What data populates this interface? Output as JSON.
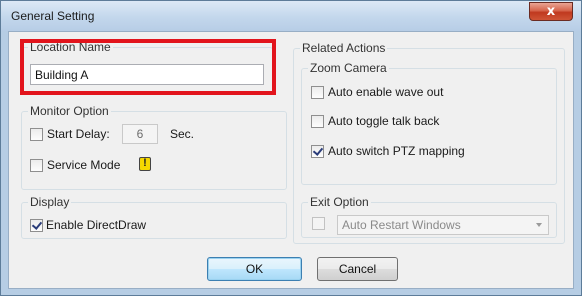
{
  "window": {
    "title": "General Setting",
    "close_glyph": "x"
  },
  "location": {
    "group_label": "Location Name",
    "value": "Building A"
  },
  "monitor": {
    "group_label": "Monitor Option",
    "start_delay_label": "Start Delay:",
    "start_delay_checked": false,
    "delay_value": "6",
    "delay_unit": "Sec.",
    "service_mode_label": "Service Mode",
    "service_mode_checked": false,
    "service_mode_icon": "exclamation-warning-icon",
    "warning_glyph": "!"
  },
  "display": {
    "group_label": "Display",
    "enable_directdraw_label": "Enable DirectDraw",
    "enable_directdraw_checked": true
  },
  "related": {
    "group_label": "Related Actions",
    "zoom_camera_label": "Zoom Camera",
    "auto_wave_out_label": "Auto enable wave out",
    "auto_wave_out_checked": false,
    "auto_talk_back_label": "Auto toggle talk back",
    "auto_talk_back_checked": false,
    "auto_ptz_label": "Auto switch PTZ mapping",
    "auto_ptz_checked": true
  },
  "exit_option": {
    "group_label": "Exit Option",
    "checked": false,
    "selected": "Auto Restart Windows"
  },
  "buttons": {
    "ok_label": "OK",
    "cancel_label": "Cancel"
  },
  "colors": {
    "highlight_box": "#e2141c",
    "close_button": "#c0391f",
    "default_button_border": "#3c7fb1"
  }
}
